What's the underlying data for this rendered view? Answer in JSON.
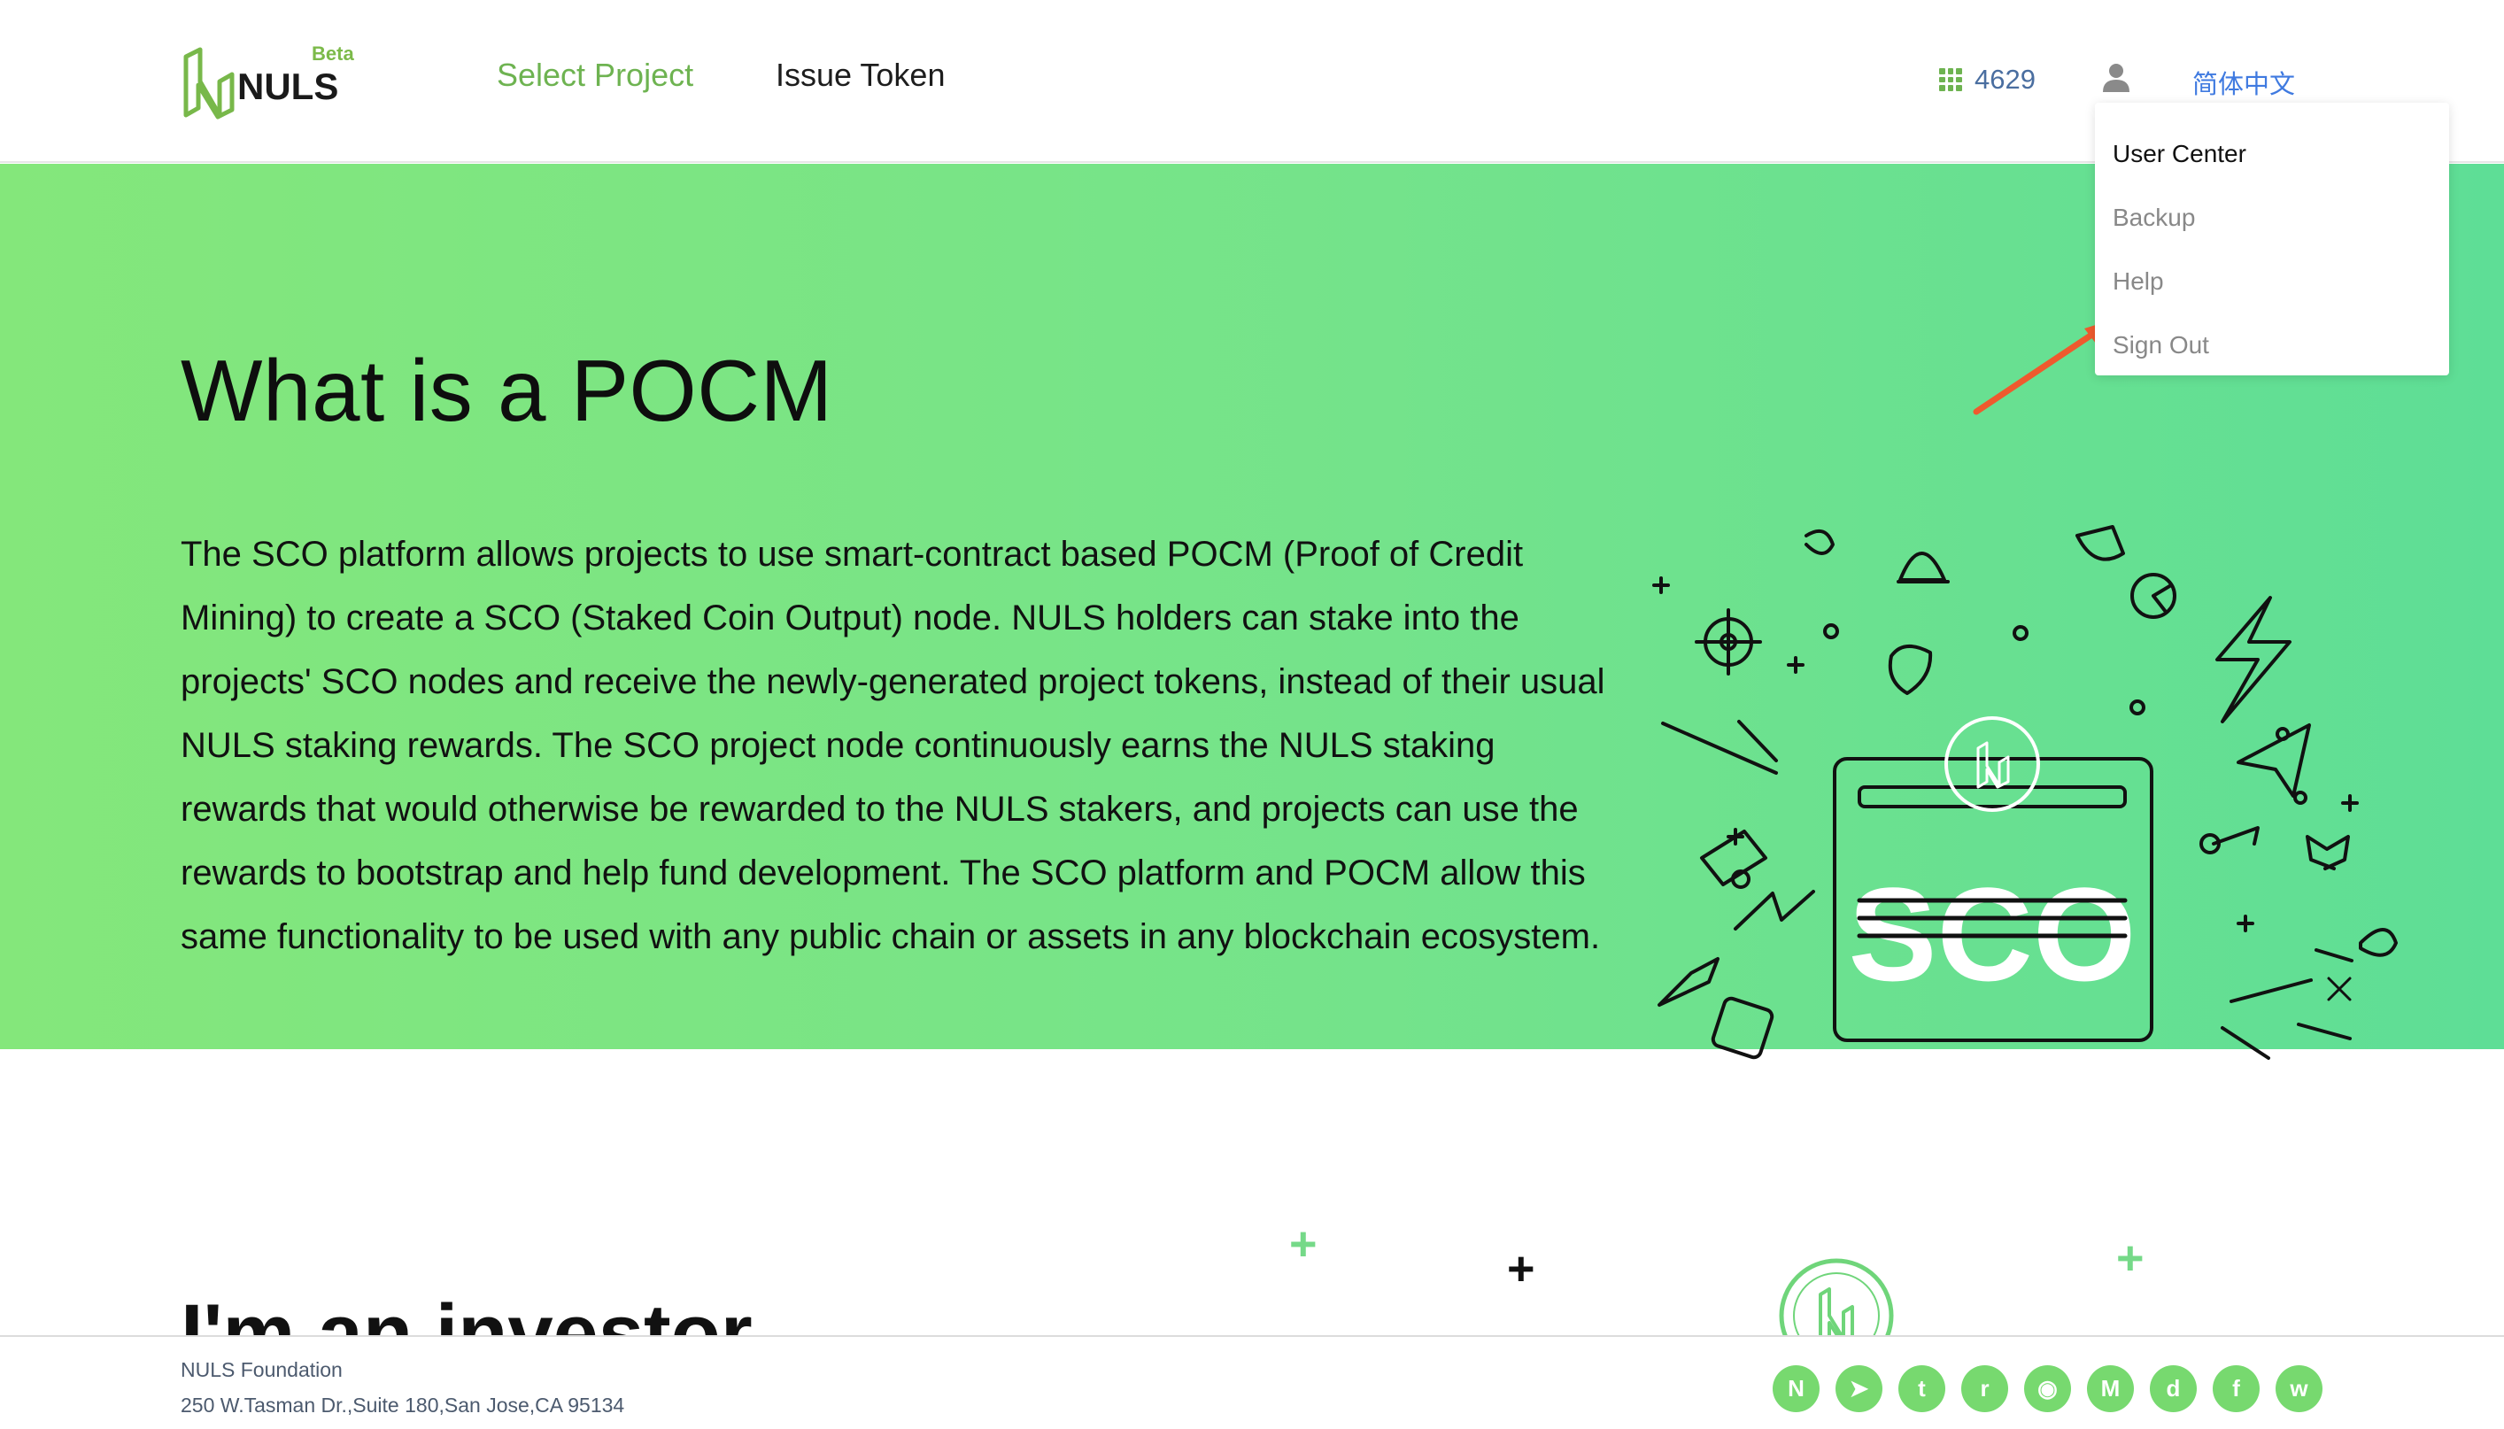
{
  "header": {
    "logo_text": "NULS",
    "beta_label": "Beta",
    "nav": [
      {
        "label": "Select Project"
      },
      {
        "label": "Issue Token"
      }
    ],
    "block_height": "4629",
    "language": "简体中文"
  },
  "user_menu": {
    "items": [
      {
        "label": "User Center"
      },
      {
        "label": "Backup"
      },
      {
        "label": "Help"
      },
      {
        "label": "Sign Out"
      }
    ]
  },
  "hero": {
    "title": "What is a POCM",
    "body": "The SCO platform allows projects to use smart-contract based POCM (Proof of Credit Mining) to create a SCO (Staked Coin Output) node. NULS holders can stake into the projects' SCO nodes and receive the newly-generated project tokens, instead of their usual NULS staking rewards. The SCO project node continuously earns the NULS staking rewards that would otherwise be rewarded to the NULS stakers, and projects can use the rewards to bootstrap and help fund development. The SCO platform and POCM allow this same functionality to be used with any public chain or assets in any blockchain ecosystem.",
    "illustration_text": "SCO"
  },
  "investor": {
    "title": "I'm an investor"
  },
  "footer": {
    "name": "NULS Foundation",
    "address": "250 W.Tasman Dr.,Suite 180,San Jose,CA 95134",
    "socials": [
      {
        "icon": "nuls-icon",
        "glyph": "N"
      },
      {
        "icon": "telegram-icon",
        "glyph": "➤"
      },
      {
        "icon": "twitter-icon",
        "glyph": "t"
      },
      {
        "icon": "reddit-icon",
        "glyph": "r"
      },
      {
        "icon": "github-icon",
        "glyph": "◉"
      },
      {
        "icon": "medium-icon",
        "glyph": "M"
      },
      {
        "icon": "discord-icon",
        "glyph": "d"
      },
      {
        "icon": "facebook-icon",
        "glyph": "f"
      },
      {
        "icon": "wechat-icon",
        "glyph": "w"
      }
    ]
  },
  "colors": {
    "accent_green": "#6eb351",
    "link_blue": "#3f7ae0",
    "hero_start": "#84e77b",
    "hero_end": "#5ede96",
    "annotation_red": "#ef5a2e"
  }
}
